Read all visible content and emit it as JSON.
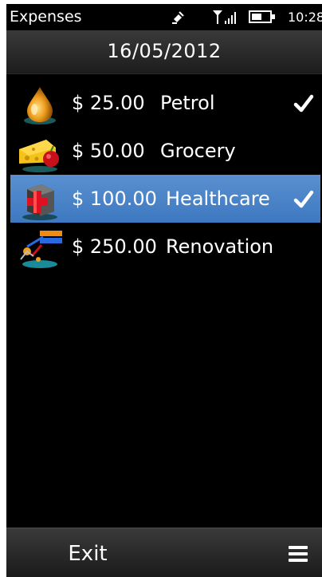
{
  "status_bar": {
    "app_name": "Expenses",
    "time": "10:28",
    "icons": [
      "satellite-icon",
      "signal-icon",
      "battery-icon"
    ]
  },
  "header": {
    "date": "16/05/2012"
  },
  "expenses": [
    {
      "amount": "$ 25.00",
      "category": "Petrol",
      "icon": "petrol-drop-icon",
      "checked": true,
      "selected": false
    },
    {
      "amount": "$ 50.00",
      "category": "Grocery",
      "icon": "grocery-cheese-icon",
      "checked": false,
      "selected": false
    },
    {
      "amount": "$ 100.00",
      "category": "Healthcare",
      "icon": "healthcare-cross-icon",
      "checked": true,
      "selected": true
    },
    {
      "amount": "$ 250.00",
      "category": "Renovation",
      "icon": "renovation-tools-icon",
      "checked": false,
      "selected": false
    }
  ],
  "softkeys": {
    "left_label": "Exit",
    "right_icon": "menu-icon"
  },
  "colors": {
    "selection": "#4a84c8",
    "background": "#000000",
    "text": "#ffffff"
  }
}
